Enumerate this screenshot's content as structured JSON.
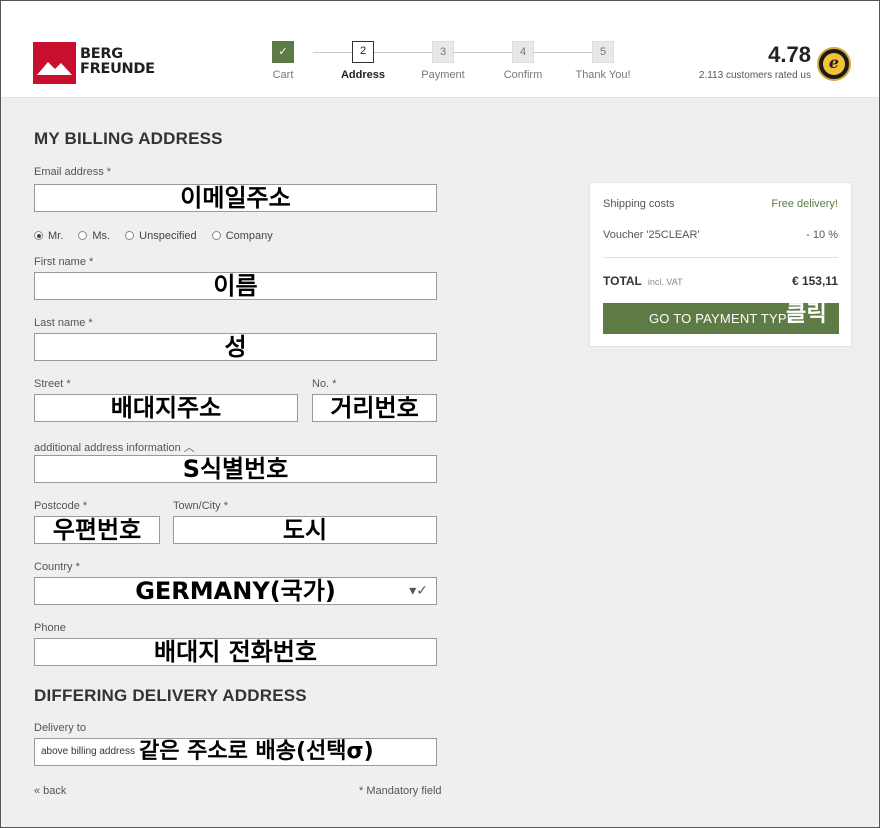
{
  "brand": {
    "line1": "BERG",
    "line2": "FREUNDE"
  },
  "steps": [
    {
      "num": "",
      "label": "Cart",
      "state": "done"
    },
    {
      "num": "2",
      "label": "Address",
      "state": "active"
    },
    {
      "num": "3",
      "label": "Payment",
      "state": ""
    },
    {
      "num": "4",
      "label": "Confirm",
      "state": ""
    },
    {
      "num": "5",
      "label": "Thank You!",
      "state": ""
    }
  ],
  "rating": {
    "score": "4.78",
    "subtitle": "2.113 customers rated us",
    "badge_letter": "e"
  },
  "billing": {
    "title": "MY BILLING ADDRESS",
    "email": {
      "label": "Email address *",
      "value": "이메일주소"
    },
    "salutations": [
      {
        "label": "Mr.",
        "checked": true
      },
      {
        "label": "Ms.",
        "checked": false
      },
      {
        "label": "Unspecified",
        "checked": false
      },
      {
        "label": "Company",
        "checked": false
      }
    ],
    "first_name": {
      "label": "First name *",
      "value": "이름"
    },
    "last_name": {
      "label": "Last name *",
      "value": "성"
    },
    "street": {
      "label": "Street *",
      "value": "배대지주소"
    },
    "number": {
      "label": "No. *",
      "value": "거리번호"
    },
    "additional": {
      "label": "additional address information ︿",
      "value": "S식별번호"
    },
    "postcode": {
      "label": "Postcode *",
      "value": "우편번호"
    },
    "town": {
      "label": "Town/City *",
      "value": "도시"
    },
    "country": {
      "label": "Country *",
      "value": "GERMANY(국가)",
      "indicator": "▾✓"
    },
    "phone": {
      "label": "Phone",
      "value": "배대지 전화번호"
    }
  },
  "delivery": {
    "title": "DIFFERING DELIVERY ADDRESS",
    "label": "Delivery to",
    "selected": "above billing address",
    "annotation": "같은 주소로 배송(선택σ)"
  },
  "footer": {
    "back": "« back",
    "mandatory": "* Mandatory field"
  },
  "summary": {
    "shipping_label": "Shipping costs",
    "shipping_value": "Free delivery!",
    "voucher_label": "Voucher '25CLEAR'",
    "voucher_value": "- 10 %",
    "total_label": "TOTAL",
    "total_note": "incl. VAT",
    "total_value": "€ 153,11",
    "button_label": "GO TO PAYMENT TYPE",
    "button_annotation": "클릭"
  },
  "colors": {
    "accent": "#5e7a45",
    "brand_red": "#c8102e"
  }
}
